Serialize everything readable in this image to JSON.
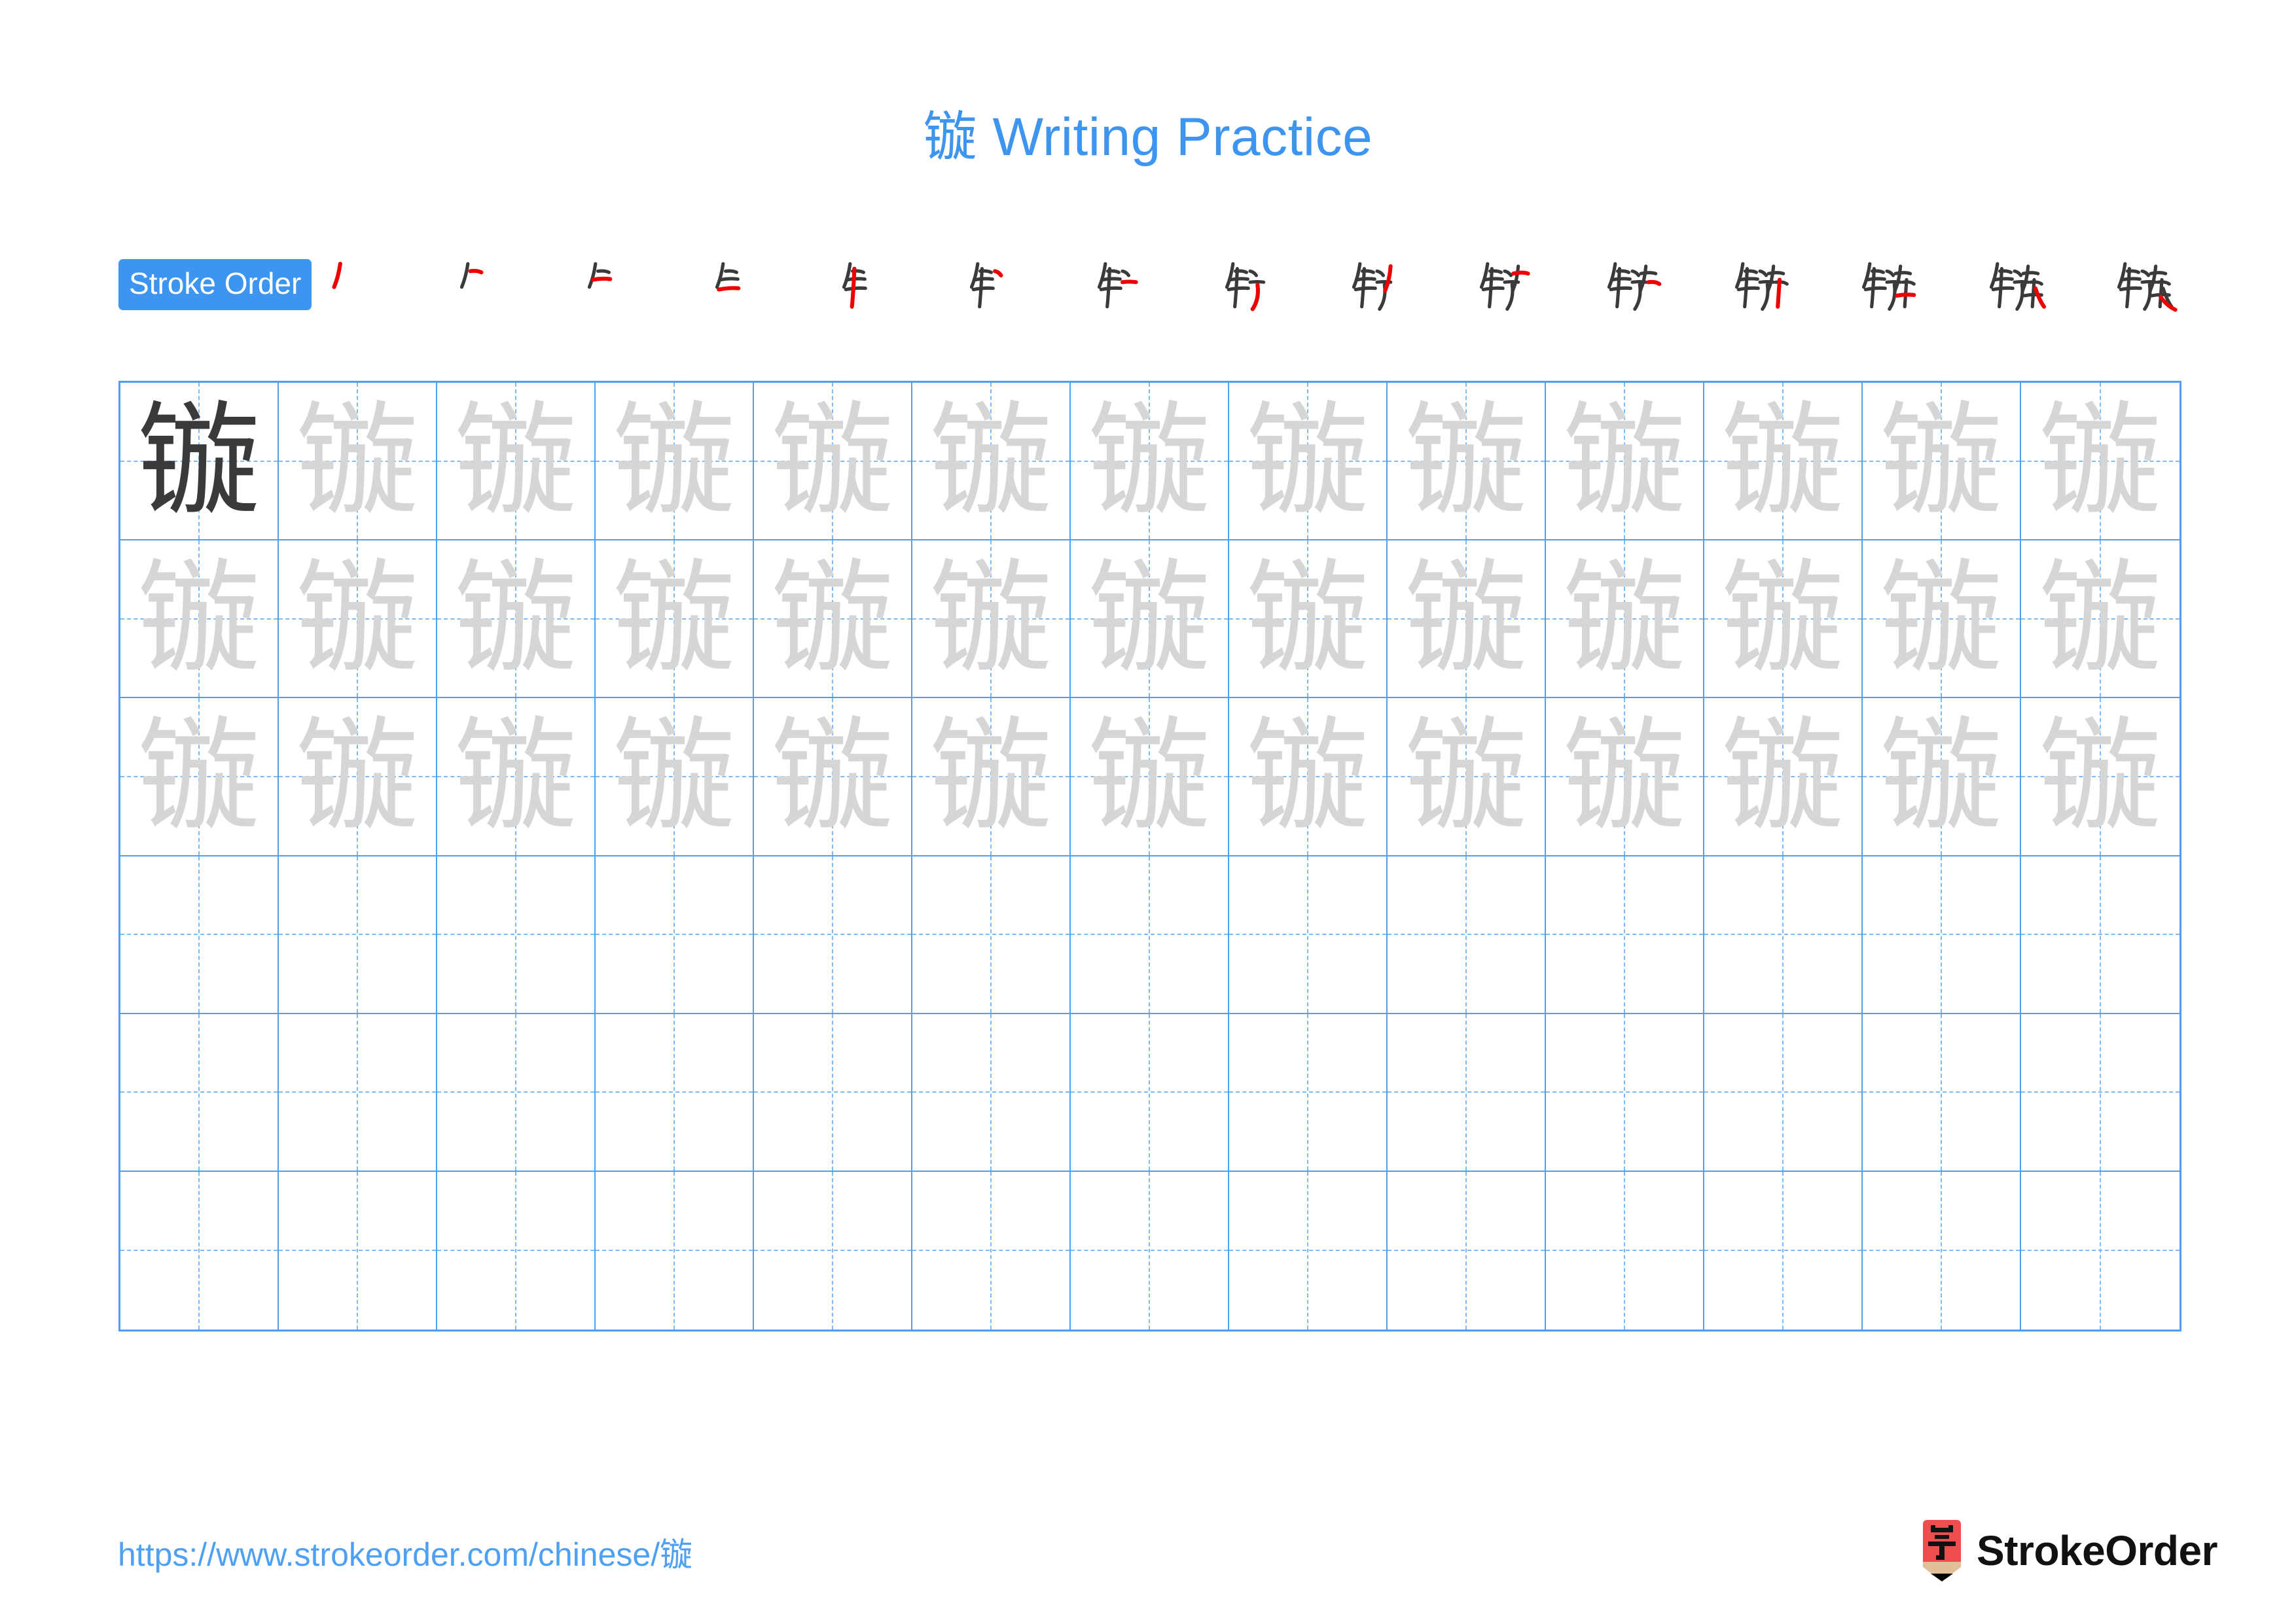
{
  "character": "镟",
  "header": {
    "title_character": "镟",
    "title_text": " Writing Practice",
    "title_full": "镟 Writing Practice",
    "title_color": "#3d95ef"
  },
  "stroke_order": {
    "label": "Stroke Order",
    "badge_bg": "#3d95ef",
    "badge_text_color": "#ffffff",
    "total_strokes": 15,
    "new_stroke_color": "#ee0000",
    "old_stroke_color": "#3a3a3c",
    "steps": [
      {
        "index": 1,
        "new_stroke": "丿"
      },
      {
        "index": 2,
        "new_stroke": "一"
      },
      {
        "index": 3,
        "new_stroke": "一"
      },
      {
        "index": 4,
        "new_stroke": "一"
      },
      {
        "index": 5,
        "new_stroke": "亅"
      },
      {
        "index": 6,
        "new_stroke": "丶"
      },
      {
        "index": 7,
        "new_stroke": "一"
      },
      {
        "index": 8,
        "new_stroke": "㇉"
      },
      {
        "index": 9,
        "new_stroke": "丿"
      },
      {
        "index": 10,
        "new_stroke": "丿"
      },
      {
        "index": 11,
        "new_stroke": "㇀"
      },
      {
        "index": 12,
        "new_stroke": "㇈"
      },
      {
        "index": 13,
        "new_stroke": "丨"
      },
      {
        "index": 14,
        "new_stroke": "一"
      },
      {
        "index": 15,
        "new_stroke": "㇏"
      }
    ]
  },
  "grid": {
    "columns": 13,
    "rows": 6,
    "border_color": "#4da0f2",
    "guide_color": "#7cb9f5",
    "dark_glyph_color": "#3a3a3c",
    "light_glyph_color": "#d6d6d6",
    "cells": [
      [
        "dark",
        "light",
        "light",
        "light",
        "light",
        "light",
        "light",
        "light",
        "light",
        "light",
        "light",
        "light",
        "light"
      ],
      [
        "light",
        "light",
        "light",
        "light",
        "light",
        "light",
        "light",
        "light",
        "light",
        "light",
        "light",
        "light",
        "light"
      ],
      [
        "light",
        "light",
        "light",
        "light",
        "light",
        "light",
        "light",
        "light",
        "light",
        "light",
        "light",
        "light",
        "light"
      ],
      [
        "blank",
        "blank",
        "blank",
        "blank",
        "blank",
        "blank",
        "blank",
        "blank",
        "blank",
        "blank",
        "blank",
        "blank",
        "blank"
      ],
      [
        "blank",
        "blank",
        "blank",
        "blank",
        "blank",
        "blank",
        "blank",
        "blank",
        "blank",
        "blank",
        "blank",
        "blank",
        "blank"
      ],
      [
        "blank",
        "blank",
        "blank",
        "blank",
        "blank",
        "blank",
        "blank",
        "blank",
        "blank",
        "blank",
        "blank",
        "blank",
        "blank"
      ]
    ]
  },
  "footer": {
    "url": "https://www.strokeorder.com/chinese/镟",
    "url_color": "#4da0f2",
    "brand_name": "StrokeOrder",
    "brand_mark_character": "字",
    "brand_mark_bg": "#f0four",
    "brand_mark_red": "#f04e4e",
    "brand_mark_wood": "#e0bf99",
    "brand_mark_tip": "#000000"
  }
}
